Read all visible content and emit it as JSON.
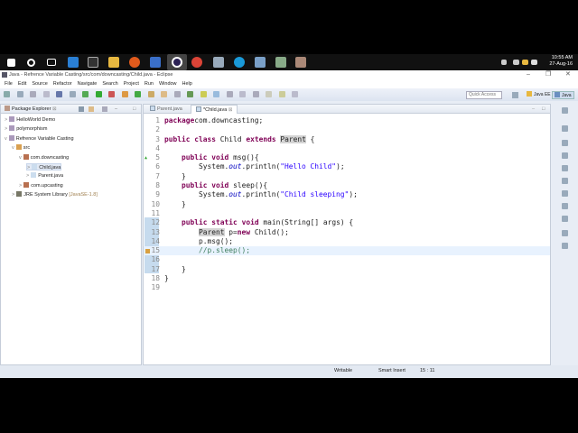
{
  "taskbar": {
    "time": "10:55 AM",
    "date": "27-Aug-16"
  },
  "window": {
    "title": "Java - Refrence Variable Casting/src/com/downcasting/Child.java - Eclipse",
    "minimize": "–",
    "maximize": "❐",
    "close": "✕"
  },
  "menu": [
    "File",
    "Edit",
    "Source",
    "Refactor",
    "Navigate",
    "Search",
    "Project",
    "Run",
    "Window",
    "Help"
  ],
  "toolbar": {
    "quick_access": "Quick Access",
    "persp_javaee": "Java EE",
    "persp_java": "Java"
  },
  "package_explorer": {
    "title": "Package Explorer",
    "items": [
      {
        "label": "HelloWorld Demo",
        "level": 0,
        "arrow": ">"
      },
      {
        "label": "polymorphism",
        "level": 0,
        "arrow": ">"
      },
      {
        "label": "Refrence Variable Casting",
        "level": 0,
        "arrow": "v"
      },
      {
        "label": "src",
        "level": 1,
        "arrow": "v"
      },
      {
        "label": "com.downcasting",
        "level": 2,
        "arrow": "v"
      },
      {
        "label": "Child.java",
        "level": 3,
        "arrow": ">"
      },
      {
        "label": "Parent.java",
        "level": 3,
        "arrow": ">"
      },
      {
        "label": "com.upcasting",
        "level": 2,
        "arrow": ">"
      },
      {
        "label": "JRE System Library",
        "suffix": "[JavaSE-1.8]",
        "level": 1,
        "arrow": ">"
      }
    ]
  },
  "editor": {
    "tabs": [
      {
        "label": "Parent.java"
      },
      {
        "label": "*Child.java"
      }
    ],
    "lines": [
      [
        [
          "kw",
          "package"
        ],
        [
          "",
          "com.downcasting;"
        ]
      ],
      [],
      [
        [
          "kw",
          "public"
        ],
        [
          "",
          " "
        ],
        [
          "kw",
          "class"
        ],
        [
          "",
          " Child "
        ],
        [
          "kw",
          "extends"
        ],
        [
          "",
          " "
        ],
        [
          "occ",
          "Parent"
        ],
        [
          "",
          " {"
        ]
      ],
      [],
      [
        [
          "",
          "    "
        ],
        [
          "kw",
          "public"
        ],
        [
          "",
          " "
        ],
        [
          "kw",
          "void"
        ],
        [
          "",
          " msg(){"
        ]
      ],
      [
        [
          "",
          "        System."
        ],
        [
          "fld",
          "out"
        ],
        [
          "",
          ".println("
        ],
        [
          "str",
          "\"Hello Child\""
        ],
        [
          "",
          ");"
        ]
      ],
      [
        [
          "",
          "    }"
        ]
      ],
      [
        [
          "",
          "    "
        ],
        [
          "kw",
          "public"
        ],
        [
          "",
          " "
        ],
        [
          "kw",
          "void"
        ],
        [
          "",
          " sleep(){"
        ]
      ],
      [
        [
          "",
          "        System."
        ],
        [
          "fld",
          "out"
        ],
        [
          "",
          ".println("
        ],
        [
          "str",
          "\"Child sleeping\""
        ],
        [
          "",
          ");"
        ]
      ],
      [
        [
          "",
          "    }"
        ]
      ],
      [],
      [
        [
          "",
          "    "
        ],
        [
          "kw",
          "public"
        ],
        [
          "",
          " "
        ],
        [
          "kw",
          "static"
        ],
        [
          "",
          " "
        ],
        [
          "kw",
          "void"
        ],
        [
          "",
          " main(String[] args) {"
        ]
      ],
      [
        [
          "",
          "        "
        ],
        [
          "occ",
          "Parent"
        ],
        [
          "",
          " p="
        ],
        [
          "kw",
          "new"
        ],
        [
          "",
          " Child();"
        ]
      ],
      [
        [
          "",
          "        p.msg();"
        ]
      ],
      [
        [
          "",
          "        "
        ],
        [
          "cmt",
          "//p.sleep();"
        ]
      ],
      [],
      [
        [
          "",
          "    }"
        ]
      ],
      [
        [
          "",
          "}"
        ]
      ],
      []
    ]
  },
  "status": {
    "writable": "Writable",
    "insert_mode": "Smart Insert",
    "position": "15 : 11"
  }
}
